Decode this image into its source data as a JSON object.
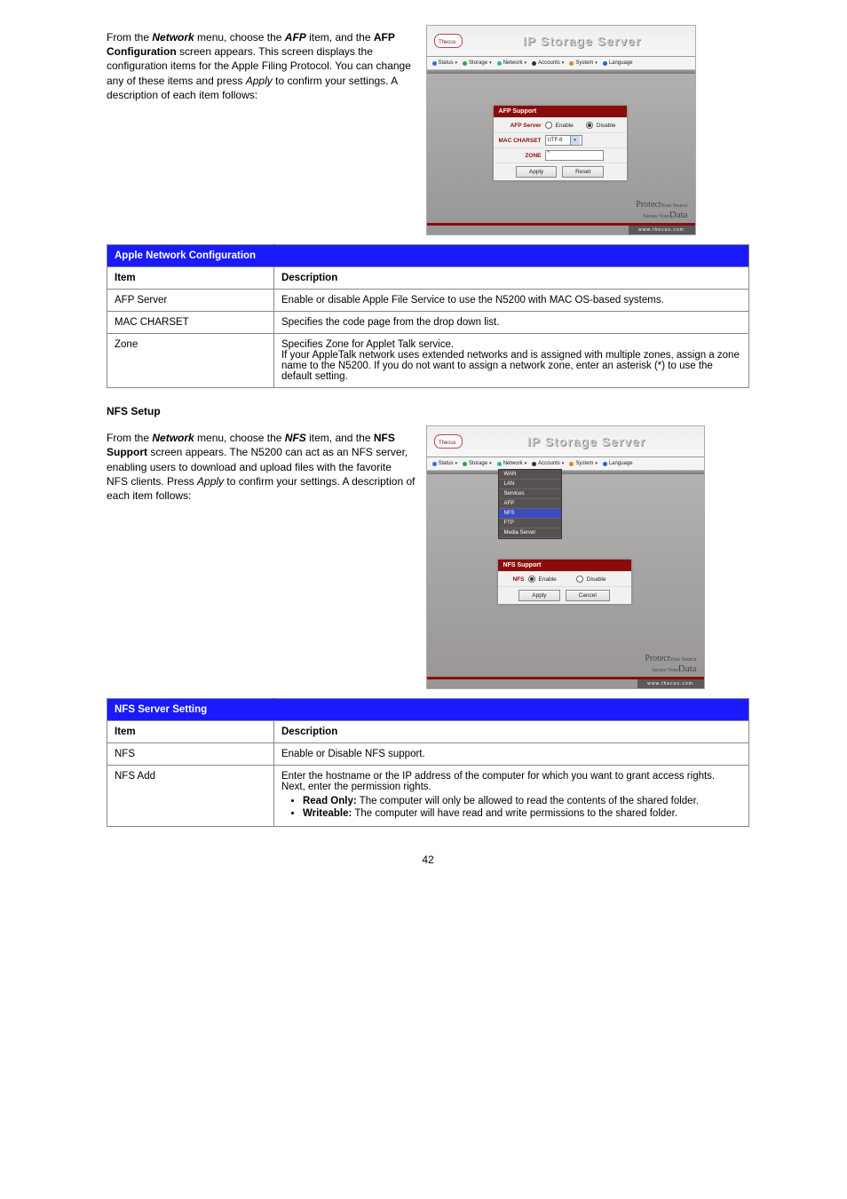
{
  "doc": {
    "intro1": "From the ",
    "intro1b": "Network",
    "intro1c": " menu, choose the ",
    "intro1d": "AFP",
    "intro1e": " item, and the ",
    "intro1f": "AFP Configuration",
    "intro1g": " screen appears. This screen displays the configuration items for the Apple Filing Protocol. You can change any of these items and press ",
    "intro1h": "Apply",
    "intro1i": " to confirm your settings. A description of each item follows:",
    "para_nfs_title": "NFS Setup",
    "nfs1": "From the ",
    "nfs1b": "Network",
    "nfs1c": " menu, choose the ",
    "nfs1d": "NFS",
    "nfs1e": " item, and the ",
    "nfs1f": "NFS Support",
    "nfs1g": " screen appears. The N5200 can act as an NFS server, enabling users to download and upload files with the favorite NFS clients. Press ",
    "nfs1h": "Apply",
    "nfs1i": " to confirm your settings. A description of each item follows:",
    "page": "42"
  },
  "table_afp": {
    "title": "Apple Network Configuration",
    "subhead_item": "Item",
    "subhead_desc": "Description",
    "rows": [
      {
        "item": "AFP Server",
        "desc": "Enable or disable Apple File Service to use the N5200 with MAC OS-based systems."
      },
      {
        "item": "MAC CHARSET",
        "desc": "Specifies the code page from the drop down list."
      },
      {
        "item": "Zone",
        "desc": "Specifies Zone for Applet Talk service.",
        "note": "If your AppleTalk network uses extended networks and is assigned with multiple zones, assign a zone name to the N5200. If you do not want to assign a network zone, enter an asterisk (*) to use the default setting."
      }
    ]
  },
  "table_nfs": {
    "title": "NFS Server Setting",
    "subhead_item": "Item",
    "subhead_desc": "Description",
    "rows": [
      {
        "item": "NFS",
        "desc": "Enable or Disable NFS support."
      },
      {
        "item": "NFS Add",
        "desc": "Enter the hostname or the IP address of the computer for which you want to grant access rights. Next, enter the permission rights.",
        "perms": [
          {
            "k": "Read Only:",
            "v": " The computer will only be allowed to read the contents of the shared folder."
          },
          {
            "k": "Writeable:",
            "v": " The computer will have read and write permissions to the shared folder."
          }
        ]
      }
    ]
  },
  "shot": {
    "banner": "IP Storage Server",
    "menus": [
      "Status",
      "Storage",
      "Network",
      "Accounts",
      "System",
      "Language"
    ],
    "brand_tag1": "Protect",
    "brand_tag2": "Your Source",
    "brand_tag3": "Secure Your",
    "brand_tag4": "Data",
    "url": "www.thecus.com",
    "afp": {
      "title": "AFP Support",
      "row1_label": "AFP Server",
      "row1_opt1": "Enable",
      "row1_opt2": "Disable",
      "row2_label": "MAC CHARSET",
      "row2_value": "UTF-8",
      "row3_label": "ZONE",
      "row3_value": "*",
      "btn_apply": "Apply",
      "btn_reset": "Reset"
    },
    "nfs": {
      "title": "NFS Support",
      "row1_label": "NFS",
      "row1_opt1": "Enable",
      "row1_opt2": "Disable",
      "btn_apply": "Apply",
      "btn_cancel": "Cancel",
      "dropdown": [
        "WAN",
        "LAN",
        "Services",
        "AFP",
        "NFS",
        "FTP",
        "Media Server"
      ]
    }
  }
}
